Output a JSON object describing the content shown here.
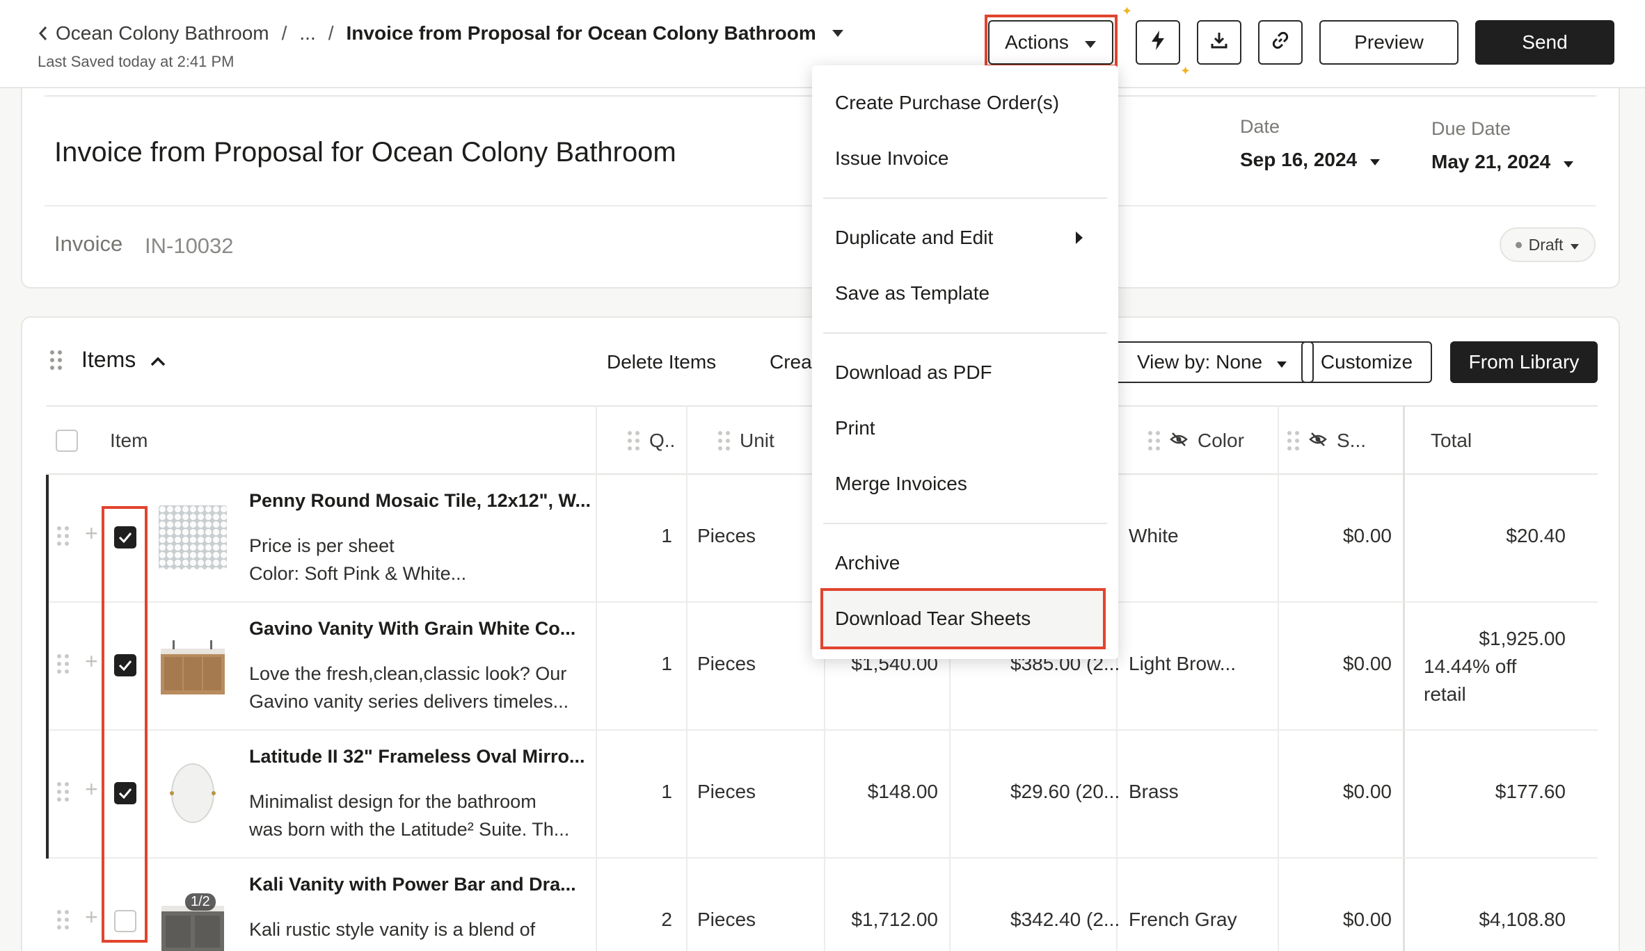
{
  "header": {
    "breadcrumb": {
      "project": "Ocean Colony Bathroom",
      "ellipsis": "...",
      "current": "Invoice from Proposal for Ocean Colony Bathroom"
    },
    "last_saved": "Last Saved today at 2:41 PM",
    "actions_label": "Actions",
    "preview_label": "Preview",
    "send_label": "Send"
  },
  "invoice": {
    "title": "Invoice from Proposal for Ocean Colony Bathroom",
    "label": "Invoice",
    "number": "IN-10032",
    "date_label": "Date",
    "date_value": "Sep 16, 2024",
    "due_label": "Due Date",
    "due_value": "May 21, 2024",
    "status": "Draft"
  },
  "items_section": {
    "title": "Items",
    "delete_label": "Delete Items",
    "create_label_partial": "Crea",
    "view_by_label": "View by: None",
    "customize_label": "Customize",
    "library_label": "From Library",
    "columns": {
      "item": "Item",
      "qty": "Q..",
      "unit": "Unit",
      "color": "Color",
      "s": "S...",
      "total": "Total"
    }
  },
  "rows": [
    {
      "name": "Penny Round Mosaic Tile, 12x12\", W...",
      "desc1": "Price is per sheet",
      "desc2": "Color: Soft Pink & White...",
      "qty": "1",
      "unit": "Pieces",
      "cost": "",
      "markup": "",
      "color": "White",
      "s": "$0.00",
      "total": "$20.40",
      "total2": "",
      "total3": "",
      "checked": true
    },
    {
      "name": "Gavino Vanity With Grain White Co...",
      "desc1": "Love the fresh,clean,classic look? Our",
      "desc2": "Gavino vanity series delivers timeles...",
      "qty": "1",
      "unit": "Pieces",
      "cost": "$1,540.00",
      "markup": "$385.00 (2...",
      "color": "Light Brow...",
      "s": "$0.00",
      "total": "$1,925.00",
      "total2": "14.44% off",
      "total3": "retail",
      "checked": true
    },
    {
      "name": "Latitude II 32\" Frameless Oval Mirro...",
      "desc1": "Minimalist design for the bathroom",
      "desc2": "was born with the Latitude² Suite. Th...",
      "qty": "1",
      "unit": "Pieces",
      "cost": "$148.00",
      "markup": "$29.60 (20...",
      "color": "Brass",
      "s": "$0.00",
      "total": "$177.60",
      "total2": "",
      "total3": "",
      "checked": true
    },
    {
      "name": "Kali Vanity with Power Bar and Dra...",
      "desc1": "Kali rustic style vanity is a blend of",
      "desc2": "",
      "qty": "2",
      "unit": "Pieces",
      "cost": "$1,712.00",
      "markup": "$342.40 (2...",
      "color": "French Gray",
      "s": "$0.00",
      "total": "$4,108.80",
      "total2": "",
      "total3": "",
      "checked": false,
      "image_badge": "1/2"
    }
  ],
  "menu": {
    "items": [
      "Create Purchase Order(s)",
      "Issue Invoice",
      "Duplicate and Edit",
      "Save as Template",
      "Download as PDF",
      "Print",
      "Merge Invoices",
      "Archive",
      "Download Tear Sheets"
    ]
  },
  "colors": {
    "highlight": "#e1442e",
    "primary_dark": "#1f1f1f",
    "sparkle": "#f0b429"
  }
}
